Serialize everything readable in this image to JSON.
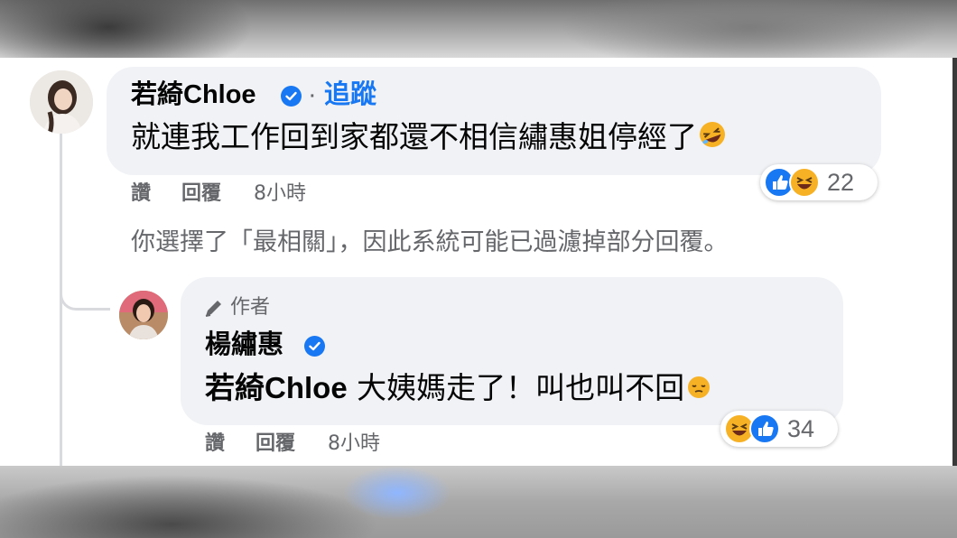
{
  "comment": {
    "author": "若綺Chloe",
    "separator": "·",
    "follow_label": "追蹤",
    "text": "就連我工作回到家都還不相信繡惠姐停經了",
    "reaction_count": "22",
    "reaction_icons": [
      "like-icon",
      "haha-icon"
    ],
    "actions": {
      "like": "讚",
      "reply": "回覆",
      "time": "8小時"
    }
  },
  "filter_notice": "你選擇了「最相關」，因此系統可能已過濾掉部分回覆。",
  "reply": {
    "badge": "作者",
    "author": "楊繡惠",
    "mention": "若綺Chloe",
    "text": "大姨媽走了！叫也叫不回",
    "reaction_count": "34",
    "reaction_icons": [
      "haha-icon",
      "like-icon"
    ],
    "actions": {
      "like": "讚",
      "reply": "回覆",
      "time": "8小時"
    }
  },
  "colors": {
    "link": "#1877f2",
    "bubble": "#f0f2f5",
    "muted": "#65676b",
    "haha": "#f7b125"
  }
}
